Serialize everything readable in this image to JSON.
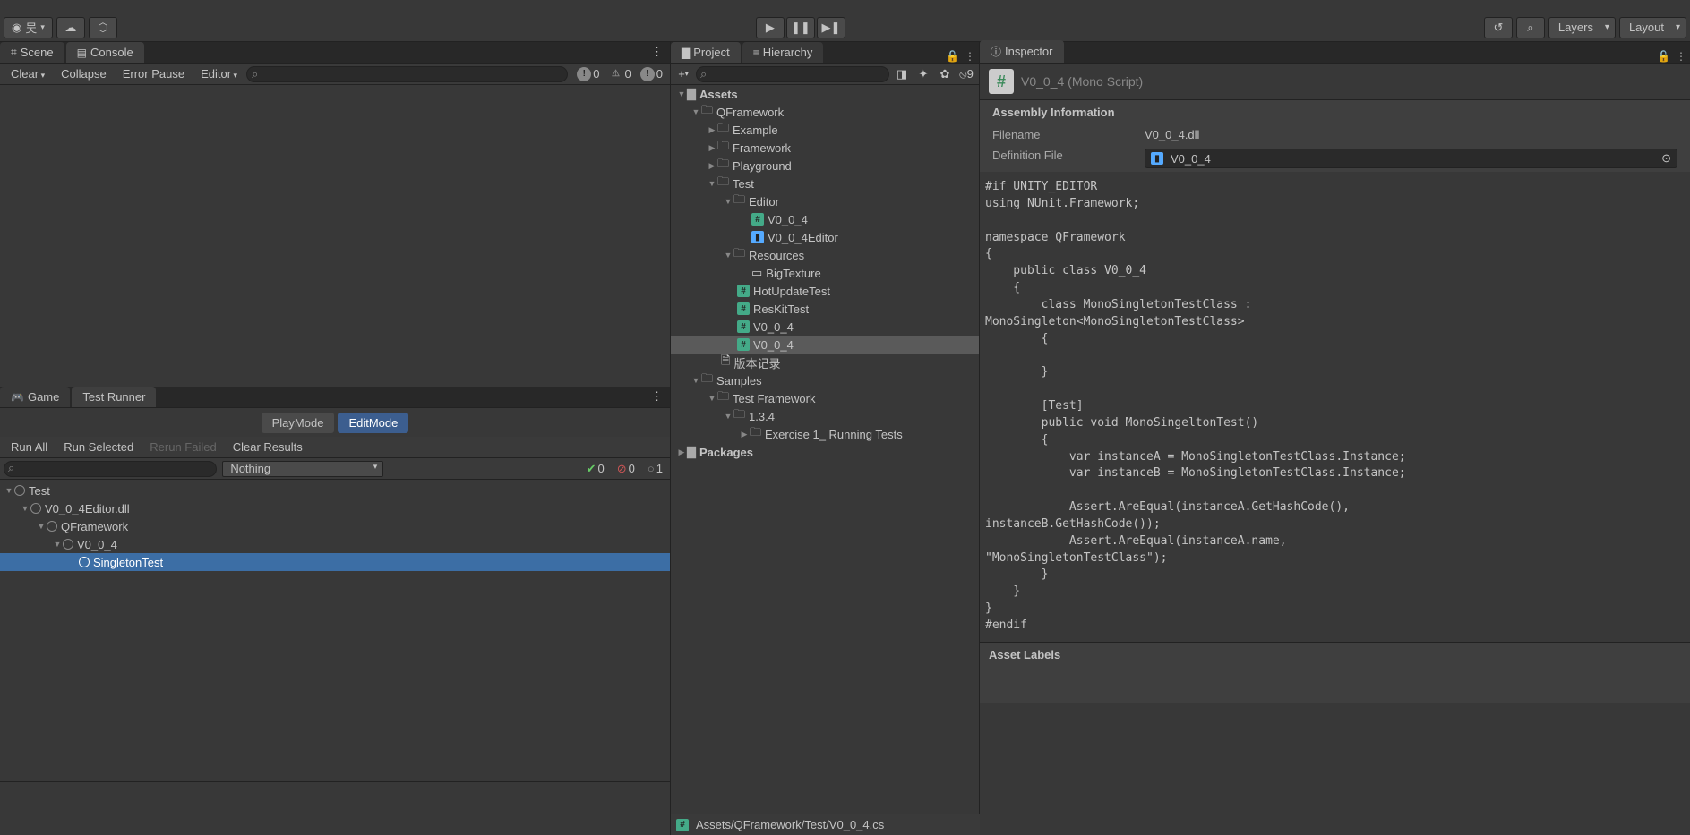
{
  "toolbar": {
    "account_label": "吴",
    "layers_label": "Layers",
    "layout_label": "Layout"
  },
  "tabs_upper": {
    "scene": "Scene",
    "console": "Console"
  },
  "console": {
    "clear": "Clear",
    "collapse": "Collapse",
    "error_pause": "Error Pause",
    "editor": "Editor",
    "info_count": "0",
    "warn_count": "0",
    "err_count": "0"
  },
  "tabs_lower": {
    "game": "Game",
    "test_runner": "Test Runner"
  },
  "runner": {
    "playmode": "PlayMode",
    "editmode": "EditMode",
    "run_all": "Run All",
    "run_selected": "Run Selected",
    "rerun_failed": "Rerun Failed",
    "clear_results": "Clear Results",
    "filter_dd": "Nothing",
    "pass": "0",
    "fail": "0",
    "skip": "1"
  },
  "test_tree": {
    "root": "Test",
    "dll": "V0_0_4Editor.dll",
    "ns": "QFramework",
    "cls": "V0_0_4",
    "test": "SingletonTest"
  },
  "tabs_mid": {
    "project": "Project",
    "hierarchy": "Hierarchy"
  },
  "hidden_count": "9",
  "project_tree": {
    "assets": "Assets",
    "qf": "QFramework",
    "example": "Example",
    "framework": "Framework",
    "playground": "Playground",
    "test": "Test",
    "editor": "Editor",
    "v004": "V0_0_4",
    "v004editor": "V0_0_4Editor",
    "resources": "Resources",
    "bigtexture": "BigTexture",
    "hotupdate": "HotUpdateTest",
    "reskit": "ResKitTest",
    "v004a": "V0_0_4",
    "v004b": "V0_0_4",
    "version": "版本记录",
    "samples": "Samples",
    "testfw": "Test Framework",
    "v134": "1.3.4",
    "exercise": "Exercise 1_ Running Tests",
    "packages": "Packages"
  },
  "path_bar": "Assets/QFramework/Test/V0_0_4.cs",
  "tabs_right": {
    "inspector": "Inspector"
  },
  "inspector": {
    "title": "V0_0_4 (Mono Script)",
    "section": "Assembly Information",
    "filename_label": "Filename",
    "filename_value": "V0_0_4.dll",
    "definition_label": "Definition File",
    "definition_value": "V0_0_4",
    "asset_labels": "Asset Labels",
    "code": "#if UNITY_EDITOR\nusing NUnit.Framework;\n\nnamespace QFramework\n{\n    public class V0_0_4\n    {\n        class MonoSingletonTestClass :\nMonoSingleton<MonoSingletonTestClass>\n        {\n\n        }\n\n        [Test]\n        public void MonoSingeltonTest()\n        {\n            var instanceA = MonoSingletonTestClass.Instance;\n            var instanceB = MonoSingletonTestClass.Instance;\n\n            Assert.AreEqual(instanceA.GetHashCode(),\ninstanceB.GetHashCode());\n            Assert.AreEqual(instanceA.name,\n\"MonoSingletonTestClass\");\n        }\n    }\n}\n#endif"
  }
}
